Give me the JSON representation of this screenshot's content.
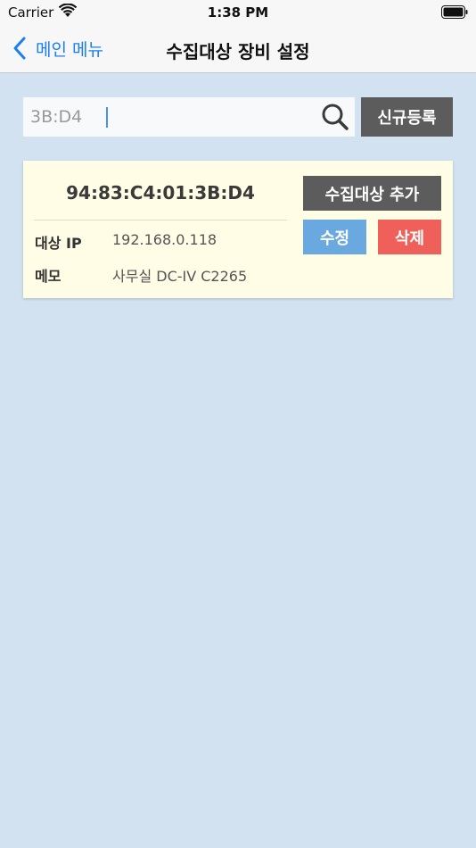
{
  "status_bar": {
    "carrier": "Carrier",
    "time": "1:38 PM",
    "wifi_icon": "wifi-icon",
    "battery_icon": "battery-icon"
  },
  "nav": {
    "back_label": "메인 메뉴",
    "title": "수집대상 장비 설정",
    "accent_color": "#1a7ff5"
  },
  "search": {
    "value": "3B:D4",
    "placeholder": "",
    "icon": "search-icon"
  },
  "toolbar": {
    "register_label": "신규등록"
  },
  "devices": [
    {
      "mac": "94:83:C4:01:3B:D4",
      "ip_label": "대상 IP",
      "ip": "192.168.0.118",
      "memo_label": "메모",
      "memo": "사무실 DC-IV C2265",
      "add_target_label": "수집대상 추가",
      "edit_label": "수정",
      "delete_label": "삭제"
    }
  ],
  "colors": {
    "background": "#d3e2f0",
    "card": "#fffde6",
    "dark_button": "#5c5c5c",
    "edit_button": "#6aa9df",
    "delete_button": "#f0605a"
  }
}
